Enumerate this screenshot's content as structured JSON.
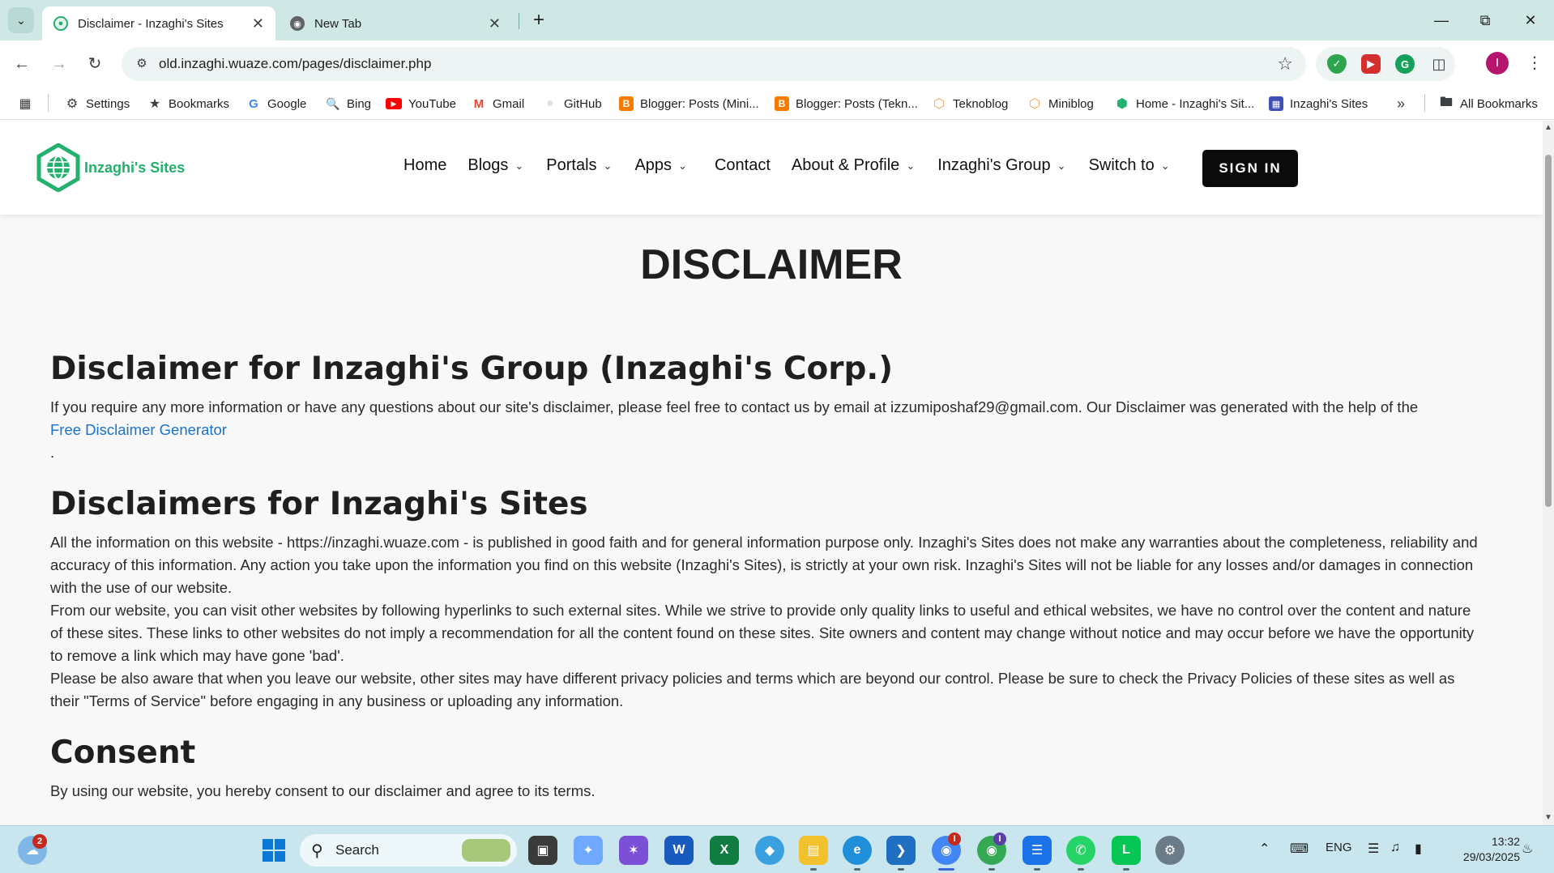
{
  "browser": {
    "tabs": [
      {
        "title": "Disclaimer - Inzaghi's Sites",
        "active": true
      },
      {
        "title": "New Tab",
        "active": false
      }
    ],
    "url": "old.inzaghi.wuaze.com/pages/disclaimer.php",
    "profile_initial": "I",
    "bookmarks": [
      {
        "label": "Settings",
        "icon": "gear-icon"
      },
      {
        "label": "Bookmarks",
        "icon": "star-icon"
      },
      {
        "label": "Google",
        "icon": "google-icon"
      },
      {
        "label": "Bing",
        "icon": "search-icon"
      },
      {
        "label": "YouTube",
        "icon": "youtube-icon"
      },
      {
        "label": "Gmail",
        "icon": "gmail-icon"
      },
      {
        "label": "GitHub",
        "icon": "github-icon"
      },
      {
        "label": "Blogger: Posts (Mini...",
        "icon": "blogger-icon"
      },
      {
        "label": "Blogger: Posts (Tekn...",
        "icon": "blogger-icon"
      },
      {
        "label": "Teknoblog",
        "icon": "hexagon-icon"
      },
      {
        "label": "Miniblog",
        "icon": "hexagon-icon"
      },
      {
        "label": "Home - Inzaghi's Sit...",
        "icon": "site-icon"
      },
      {
        "label": "Inzaghi's Sites",
        "icon": "site-icon"
      }
    ],
    "all_bookmarks_label": "All Bookmarks"
  },
  "site": {
    "logo_text": "Inzaghi's Sites",
    "nav": [
      {
        "label": "Home",
        "dropdown": false
      },
      {
        "label": "Blogs",
        "dropdown": true
      },
      {
        "label": "Portals",
        "dropdown": true
      },
      {
        "label": "Apps",
        "dropdown": true
      },
      {
        "label": "Contact",
        "dropdown": false
      },
      {
        "label": "About & Profile",
        "dropdown": true
      },
      {
        "label": "Inzaghi's Group",
        "dropdown": true
      },
      {
        "label": "Switch to",
        "dropdown": true
      }
    ],
    "signin_label": "SIGN IN",
    "accent_color": "#24b06d"
  },
  "page": {
    "title": "DISCLAIMER",
    "section1": {
      "heading": "Disclaimer for Inzaghi's Group (Inzaghi's Corp.)",
      "text": "If you require any more information or have any questions about our site's disclaimer, please feel free to contact us by email at izzumiposhaf29@gmail.com. Our Disclaimer was generated with the help of the",
      "link": "Free Disclaimer Generator",
      "trailing": "."
    },
    "section2": {
      "heading": "Disclaimers for Inzaghi's Sites",
      "p1": "All the information on this website - https://inzaghi.wuaze.com - is published in good faith and for general information purpose only. Inzaghi's Sites does not make any warranties about the completeness, reliability and accuracy of this information. Any action you take upon the information you find on this website (Inzaghi's Sites), is strictly at your own risk. Inzaghi's Sites will not be liable for any losses and/or damages in connection with the use of our website.",
      "p2": "From our website, you can visit other websites by following hyperlinks to such external sites. While we strive to provide only quality links to useful and ethical websites, we have no control over the content and nature of these sites. These links to other websites do not imply a recommendation for all the content found on these sites. Site owners and content may change without notice and may occur before we have the opportunity to remove a link which may have gone 'bad'.",
      "p3": "Please be also aware that when you leave our website, other sites may have different privacy policies and terms which are beyond our control. Please be sure to check the Privacy Policies of these sites as well as their \"Terms of Service\" before engaging in any business or uploading any information."
    },
    "section3": {
      "heading": "Consent",
      "text": "By using our website, you hereby consent to our disclaimer and agree to its terms."
    }
  },
  "taskbar": {
    "search_placeholder": "Search",
    "weather_badge": "2",
    "language": "ENG",
    "time": "13:32",
    "date": "29/03/2025"
  }
}
